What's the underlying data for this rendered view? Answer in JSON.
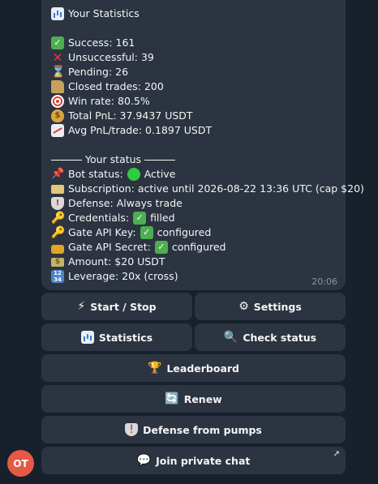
{
  "message": {
    "title": "Your Statistics",
    "stats": [
      {
        "icon": "chart-icon",
        "text": "Success: 161"
      },
      {
        "icon": "check-icon",
        "text": "Unsuccessful: 39"
      },
      {
        "icon": "hourglass-icon",
        "text": "Pending: 26"
      },
      {
        "icon": "folder-icon",
        "text": "Closed trades: 200"
      },
      {
        "icon": "target-icon",
        "text": "Win rate: 80.5%"
      },
      {
        "icon": "money-bag-icon",
        "text": "Total PnL: 37.9437 USDT"
      },
      {
        "icon": "trend-chart-icon",
        "text": "Avg PnL/trade: 0.1897 USDT"
      }
    ],
    "status_header": "Your status",
    "bot_status_label": "Bot status:",
    "bot_status_value": "Active",
    "subscription": "Subscription: active until 2026-08-22 13:36 UTC (cap $20)",
    "defense": "Defense: Always trade",
    "credentials_label": "Credentials:",
    "credentials_value": "filled",
    "gate_key_label": "Gate API Key:",
    "gate_key_value": "configured",
    "gate_secret_label": "Gate API Secret:",
    "gate_secret_value": "configured",
    "amount": "Amount: $20 USDT",
    "leverage": "Leverage: 20x (cross)",
    "time": "20:06"
  },
  "buttons": {
    "start_stop": "Start / Stop",
    "settings": "Settings",
    "statistics": "Statistics",
    "check_status": "Check status",
    "leaderboard": "Leaderboard",
    "renew": "Renew",
    "defense": "Defense from pumps",
    "join_chat": "Join private chat"
  },
  "avatar": {
    "initials": "OT"
  },
  "colors": {
    "background": "#17212b",
    "bubble": "#2b3440",
    "avatar": "#e55a45",
    "text": "#f5f5f5",
    "time": "#8a96a3"
  }
}
